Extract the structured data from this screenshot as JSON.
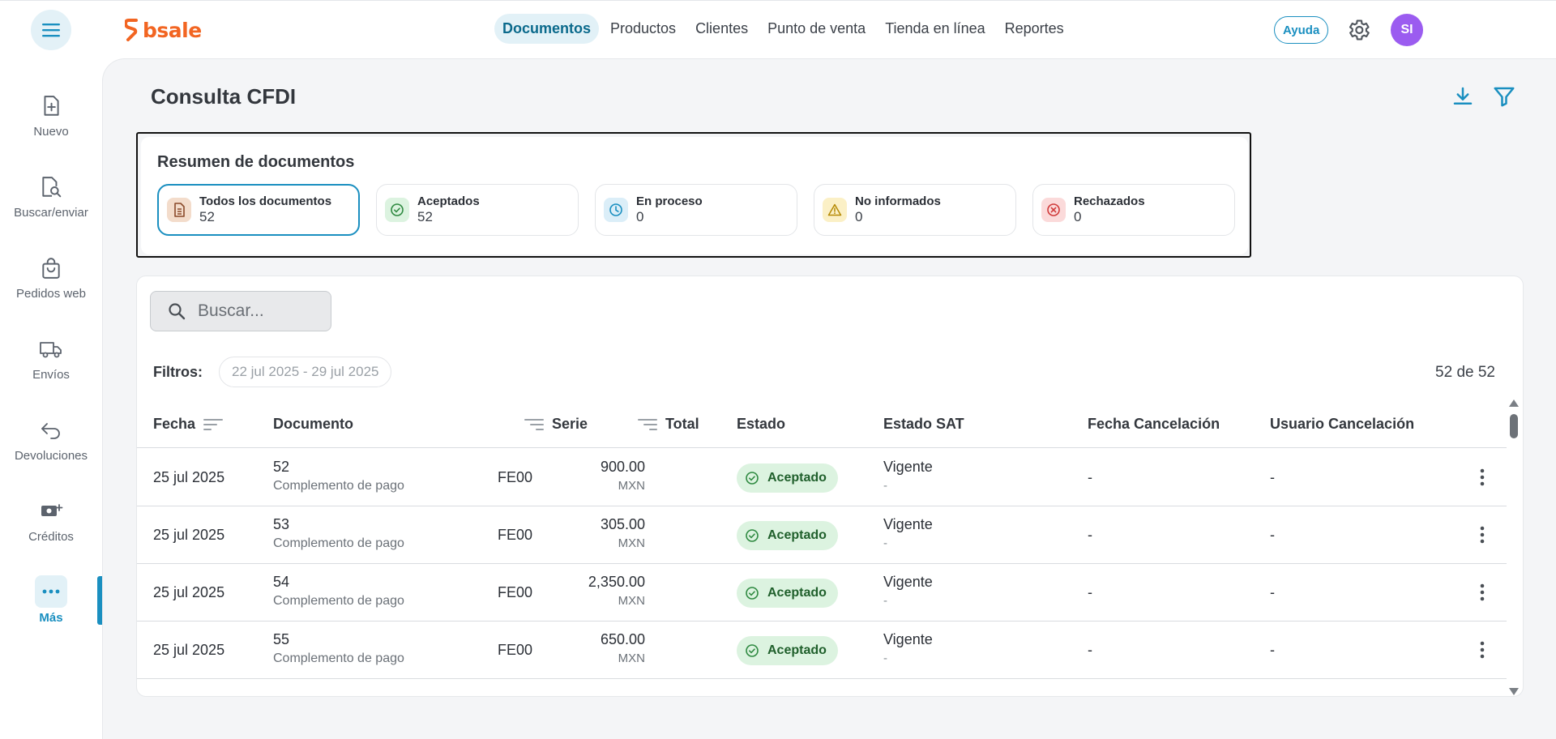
{
  "brand": {
    "name": "bsale",
    "color": "#f26522"
  },
  "topnav": {
    "items": [
      {
        "label": "Documentos",
        "active": true
      },
      {
        "label": "Productos"
      },
      {
        "label": "Clientes"
      },
      {
        "label": "Punto de venta"
      },
      {
        "label": "Tienda en línea"
      },
      {
        "label": "Reportes"
      }
    ],
    "help_label": "Ayuda",
    "avatar_initials": "SI"
  },
  "sidebar": {
    "items": [
      {
        "label": "Nuevo",
        "icon": "file-plus-icon"
      },
      {
        "label": "Buscar/enviar",
        "icon": "file-search-icon"
      },
      {
        "label": "Pedidos web",
        "icon": "shopping-bag-icon"
      },
      {
        "label": "Envíos",
        "icon": "truck-icon"
      },
      {
        "label": "Devoluciones",
        "icon": "return-arrow-icon"
      },
      {
        "label": "Créditos",
        "icon": "money-plus-icon"
      },
      {
        "label": "Más",
        "icon": "more-horizontal-icon",
        "active": true
      }
    ]
  },
  "page": {
    "title": "Consulta CFDI"
  },
  "summary": {
    "title": "Resumen de documentos",
    "cards": [
      {
        "label": "Todos los documentos",
        "count": "52",
        "selected": true,
        "icon": "document-icon",
        "color": "#f3dccb"
      },
      {
        "label": "Aceptados",
        "count": "52",
        "icon": "check-circle-icon",
        "color": "#dcf3e0"
      },
      {
        "label": "En proceso",
        "count": "0",
        "icon": "clock-icon",
        "color": "#dbeef8"
      },
      {
        "label": "No informados",
        "count": "0",
        "icon": "warning-icon",
        "color": "#fbf0c6"
      },
      {
        "label": "Rechazados",
        "count": "0",
        "icon": "x-circle-icon",
        "color": "#fbdada"
      }
    ]
  },
  "search": {
    "placeholder": "Buscar..."
  },
  "filters": {
    "label": "Filtros:",
    "date_range": "22 jul 2025 - 29 jul 2025",
    "count": "52 de 52"
  },
  "table": {
    "columns": [
      "Fecha",
      "Documento",
      "Serie",
      "Total",
      "Estado",
      "Estado SAT",
      "Fecha Cancelación",
      "Usuario Cancelación"
    ],
    "rows": [
      {
        "fecha": "25 jul 2025",
        "documento": "52",
        "tipo": "Complemento de pago",
        "serie": "FE00",
        "total": "900.00",
        "moneda": "MXN",
        "estado": "Aceptado",
        "estado_sat": "Vigente",
        "estado_sat_detalle": "-",
        "fecha_cancelacion": "-",
        "usuario_cancelacion": "-"
      },
      {
        "fecha": "25 jul 2025",
        "documento": "53",
        "tipo": "Complemento de pago",
        "serie": "FE00",
        "total": "305.00",
        "moneda": "MXN",
        "estado": "Aceptado",
        "estado_sat": "Vigente",
        "estado_sat_detalle": "-",
        "fecha_cancelacion": "-",
        "usuario_cancelacion": "-"
      },
      {
        "fecha": "25 jul 2025",
        "documento": "54",
        "tipo": "Complemento de pago",
        "serie": "FE00",
        "total": "2,350.00",
        "moneda": "MXN",
        "estado": "Aceptado",
        "estado_sat": "Vigente",
        "estado_sat_detalle": "-",
        "fecha_cancelacion": "-",
        "usuario_cancelacion": "-"
      },
      {
        "fecha": "25 jul 2025",
        "documento": "55",
        "tipo": "Complemento de pago",
        "serie": "FE00",
        "total": "650.00",
        "moneda": "MXN",
        "estado": "Aceptado",
        "estado_sat": "Vigente",
        "estado_sat_detalle": "-",
        "fecha_cancelacion": "-",
        "usuario_cancelacion": "-"
      }
    ]
  },
  "colors": {
    "accent": "#1a8fc0",
    "accepted_bg": "#dcf3e0",
    "accepted_text": "#1f5f2b"
  }
}
